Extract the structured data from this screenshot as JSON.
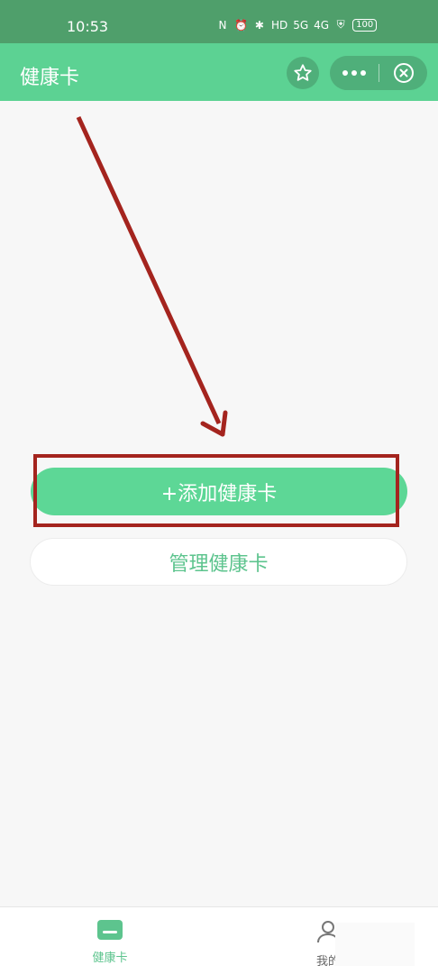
{
  "status_bar": {
    "time": "10:53",
    "icons": [
      "nfc-icon",
      "alarm-icon",
      "bluetooth-icon",
      "hd-icon",
      "signal-5g-icon",
      "signal-4g-icon",
      "shield-icon"
    ],
    "labels": {
      "hd": "HD",
      "net5g": "5G",
      "net4g": "4G"
    },
    "battery": "100"
  },
  "header": {
    "title": "健康卡",
    "bg_color": "#5cd293"
  },
  "main": {
    "add_button": "+添加健康卡",
    "manage_button": "管理健康卡",
    "accent_color": "#5dd796",
    "annotation_color": "#a4241e"
  },
  "tabbar": {
    "items": [
      {
        "label": "健康卡",
        "icon": "card-icon",
        "active": true
      },
      {
        "label": "我的",
        "icon": "person-icon",
        "active": false
      }
    ]
  }
}
